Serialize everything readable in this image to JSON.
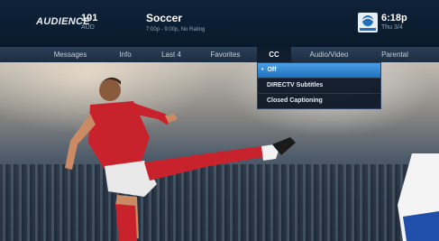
{
  "header": {
    "logo_text": "AUDIENCE",
    "channel_number": "101",
    "channel_callsign": "AUD",
    "program_title": "Soccer",
    "program_subtitle": "7:00p - 9:00p, No Rating",
    "clock_time": "6:18p",
    "clock_date": "Thu 3/4"
  },
  "tabs": [
    {
      "label": "Messages"
    },
    {
      "label": "Info"
    },
    {
      "label": "Last 4"
    },
    {
      "label": "Favorites"
    },
    {
      "label": "CC",
      "active": true
    },
    {
      "label": "Audio/Video"
    },
    {
      "label": "Parental"
    }
  ],
  "cc_menu": {
    "items": [
      {
        "label": "Off",
        "selected": true
      },
      {
        "label": "DIRECTV Subtitles"
      },
      {
        "label": "Closed Captioning"
      }
    ]
  },
  "colors": {
    "accent": "#2f86d6",
    "bar_background": "#0e2238"
  }
}
